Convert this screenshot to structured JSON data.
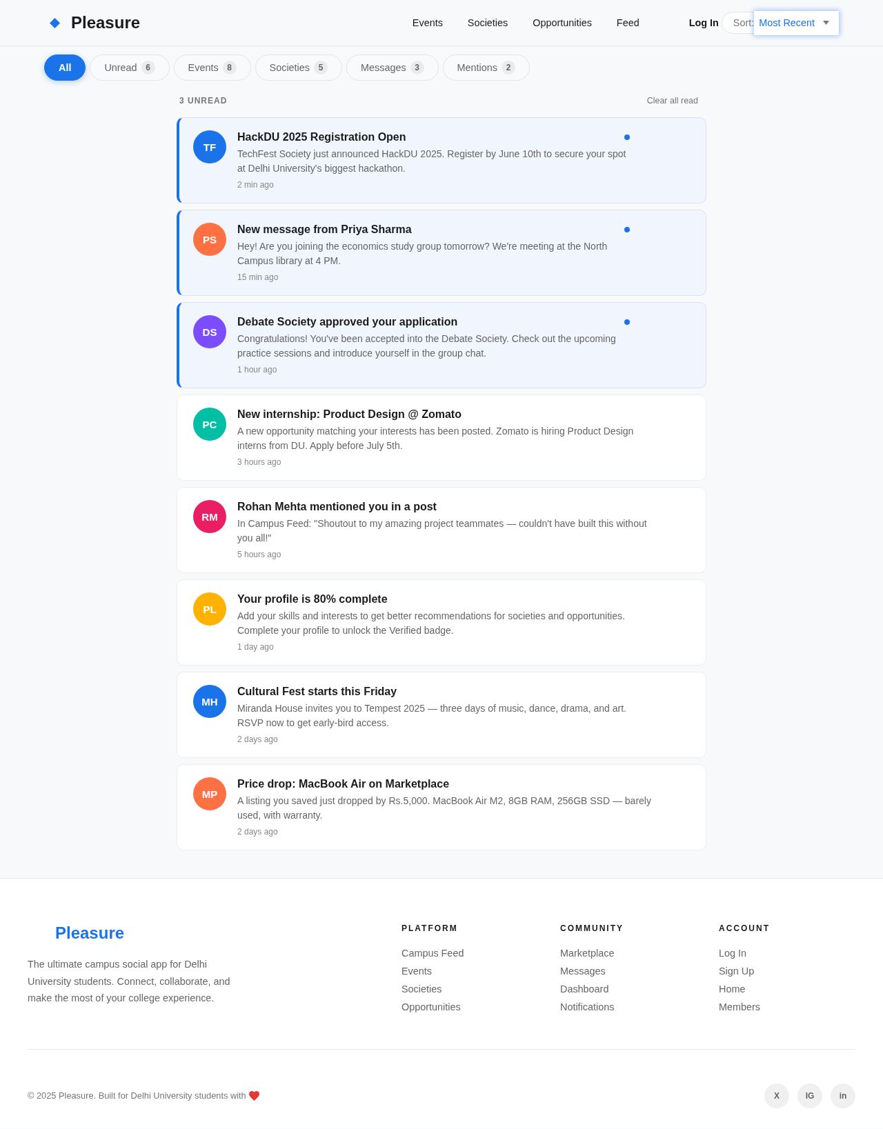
{
  "header": {
    "logo": "Pleasure",
    "nav": [
      "Events",
      "Societies",
      "Opportunities",
      "Feed"
    ],
    "login": "Log In",
    "sort": {
      "label": "Sort:",
      "value": "Most Recent",
      "focused": true
    }
  },
  "filter_tabs": [
    {
      "label": "All",
      "selected": true
    },
    {
      "label": "Unread",
      "count": "6",
      "selected": false
    },
    {
      "label": "Events",
      "count": "8",
      "selected": false
    },
    {
      "label": "Societies",
      "count": "5",
      "selected": false
    },
    {
      "label": "Messages",
      "count": "3",
      "selected": false
    },
    {
      "label": "Mentions",
      "count": "2",
      "selected": false
    }
  ],
  "summary": {
    "label": "3 UNREAD",
    "action": "Clear all read"
  },
  "notifications": [
    {
      "initials": "TF",
      "color": "#1a73e8",
      "title": "HackDU 2025 Registration Open",
      "text": "TechFest Society just announced HackDU 2025. Register by June 10th to secure your spot at Delhi University's biggest hackathon.",
      "time": "2 min ago",
      "unread": true
    },
    {
      "initials": "PS",
      "color": "#ff7043",
      "title": "New message from Priya Sharma",
      "text": "Hey! Are you joining the economics study group tomorrow? We're meeting at the North Campus library at 4 PM.",
      "time": "15 min ago",
      "unread": true
    },
    {
      "initials": "DS",
      "color": "#7c4dff",
      "title": "Debate Society approved your application",
      "text": "Congratulations! You've been accepted into the Debate Society. Check out the upcoming practice sessions and introduce yourself in the group chat.",
      "time": "1 hour ago",
      "unread": true
    },
    {
      "initials": "PC",
      "color": "#00bfa5",
      "title": "New internship: Product Design @ Zomato",
      "text": "A new opportunity matching your interests has been posted. Zomato is hiring Product Design interns from DU. Apply before July 5th.",
      "time": "3 hours ago",
      "unread": false
    },
    {
      "initials": "RM",
      "color": "#e91e63",
      "title": "Rohan Mehta mentioned you in a post",
      "text": "In Campus Feed: \"Shoutout to my amazing project teammates — couldn't have built this without you all!\"",
      "time": "5 hours ago",
      "unread": false
    },
    {
      "initials": "PL",
      "color": "#ffb300",
      "title": "Your profile is 80% complete",
      "text": "Add your skills and interests to get better recommendations for societies and opportunities. Complete your profile to unlock the Verified badge.",
      "time": "1 day ago",
      "unread": false
    },
    {
      "initials": "MH",
      "color": "#1a73e8",
      "title": "Cultural Fest starts this Friday",
      "text": "Miranda House invites you to Tempest 2025 — three days of music, dance, drama, and art. RSVP now to get early-bird access.",
      "time": "2 days ago",
      "unread": false
    },
    {
      "initials": "MP",
      "color": "#ff7043",
      "title": "Price drop: MacBook Air on Marketplace",
      "text": "A listing you saved just dropped by Rs.5,000. MacBook Air M2, 8GB RAM, 256GB SSD — barely used, with warranty.",
      "time": "2 days ago",
      "unread": false
    }
  ],
  "footer": {
    "logo": "Pleasure",
    "description": "The ultimate campus social app for Delhi University students. Connect, collaborate, and make the most of your college experience.",
    "columns": [
      {
        "heading": "PLATFORM",
        "links": [
          "Campus Feed",
          "Events",
          "Societies",
          "Opportunities"
        ]
      },
      {
        "heading": "COMMUNITY",
        "links": [
          "Marketplace",
          "Messages",
          "Dashboard",
          "Notifications"
        ]
      },
      {
        "heading": "ACCOUNT",
        "links": [
          "Log In",
          "Sign Up",
          "Home",
          "Members"
        ]
      }
    ],
    "copyright": "© 2025 Pleasure. Built for Delhi University students with",
    "social": [
      "X",
      "IG",
      "in"
    ]
  }
}
